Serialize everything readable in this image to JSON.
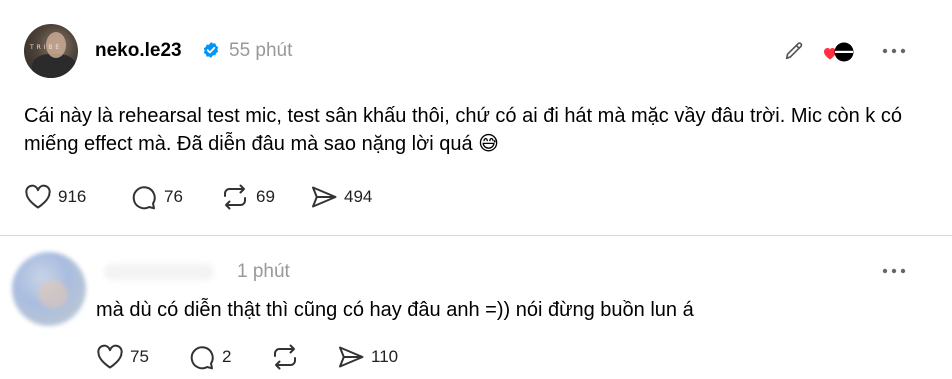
{
  "post": {
    "username": "neko.le23",
    "time": "55 phút",
    "avatar_tag": "T R I B E",
    "text": "Cái này là rehearsal test mic, test sân khấu thôi, chứ có ai đi hát mà mặc vầy đâu trời. Mic còn k có miếng effect mà. Đã diễn đâu mà sao nặng lời quá 😅",
    "stats": {
      "likes": "916",
      "replies": "76",
      "reposts": "69",
      "shares": "494"
    },
    "icons": [
      "verified-badge-icon",
      "edit-pen-icon",
      "reaction-icon",
      "more-icon",
      "heart-icon",
      "comment-icon",
      "repost-icon",
      "share-icon"
    ],
    "colors": {
      "verified": "#0095F6",
      "reaction_heart": "#FF3040",
      "muted_text": "#999999"
    }
  },
  "reply": {
    "time": "1 phút",
    "text": "mà dù có diễn thật thì cũng có hay đâu anh =)) nói đừng buồn lun á",
    "stats": {
      "likes": "75",
      "replies": "2",
      "shares": "110"
    }
  }
}
